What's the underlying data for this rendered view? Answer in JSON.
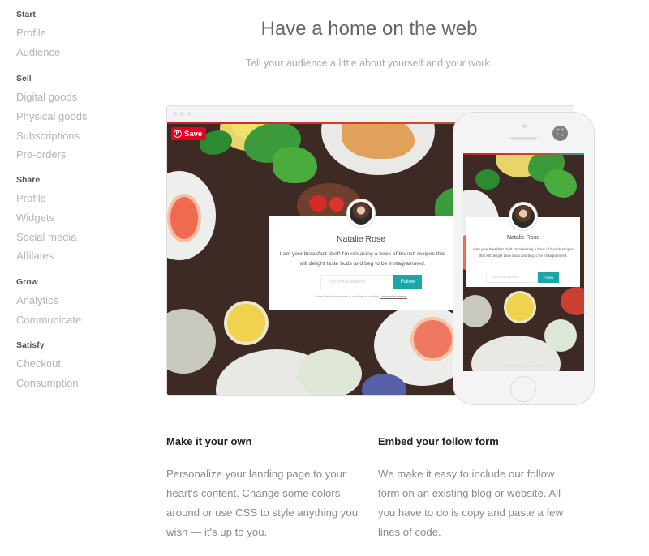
{
  "sidebar": {
    "sections": [
      {
        "title": "Start",
        "items": [
          "Profile",
          "Audience"
        ]
      },
      {
        "title": "Sell",
        "items": [
          "Digital goods",
          "Physical goods",
          "Subscriptions",
          "Pre-orders"
        ]
      },
      {
        "title": "Share",
        "items": [
          "Profile",
          "Widgets",
          "Social media",
          "Affilates"
        ]
      },
      {
        "title": "Grow",
        "items": [
          "Analytics",
          "Communicate"
        ]
      },
      {
        "title": "Satisfy",
        "items": [
          "Checkout",
          "Consumption"
        ]
      }
    ]
  },
  "header": {
    "title": "Have a home on the web",
    "subtitle": "Tell your audience a little about yourself and your work."
  },
  "preview": {
    "save_label": "Save",
    "save_icon": "pinterest-icon",
    "profile": {
      "name": "Natalie Rose",
      "bio": "I am your breakfast chef! I'm releasing a book of brunch recipes that will delight taste buds and beg to be Instagrammed.",
      "email_placeholder": "Your email address",
      "follow_label": "Follow",
      "fine_print": "Follow Natalie for updates on what they're creating.",
      "unsubscribe_label": "Unsubscribe anytime."
    },
    "phone": {
      "expand_icon": "expand-icon",
      "powered_by": "POWERED BY ◻ GUMROAD"
    },
    "colors": {
      "accent": "#1aa7a8",
      "save_red": "#e60023"
    }
  },
  "features": [
    {
      "title": "Make it your own",
      "text": "Personalize your landing page to your heart's content. Change some colors around or use CSS to style anything you wish — it's up to you."
    },
    {
      "title": "Embed your follow form",
      "text": "We make it easy to include our follow form on an existing blog or website. All you have to do is copy and paste a few lines of code."
    }
  ]
}
